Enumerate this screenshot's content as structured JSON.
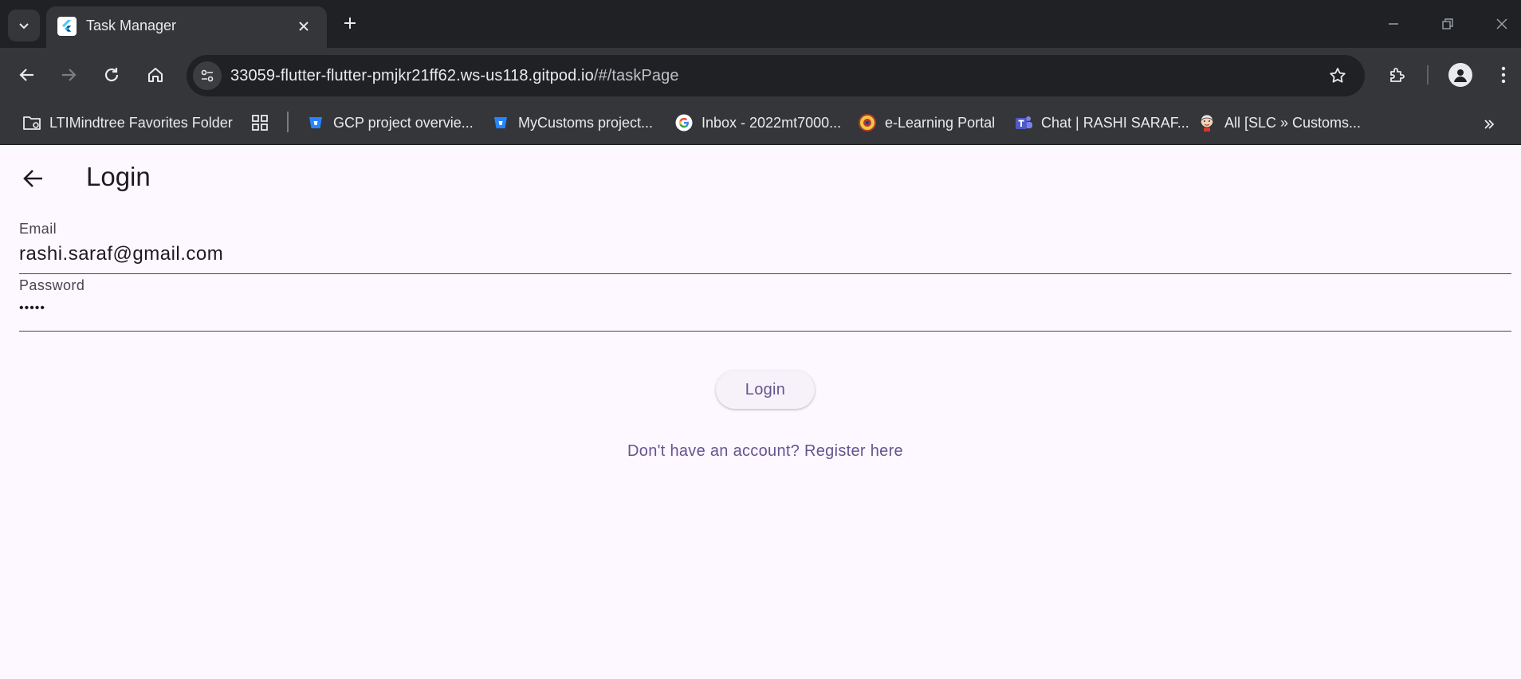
{
  "browser": {
    "tab": {
      "title": "Task Manager"
    },
    "address_bar": {
      "url_host": "33059-flutter-flutter-pmjkr21ff62.ws-us118.gitpod.io",
      "url_path": "/#/taskPage"
    },
    "bookmarks": [
      {
        "label": "LTIMindtree Favorites Folder",
        "icon": "folder-managed-icon"
      },
      {
        "label": "GCP project overvie...",
        "icon": "bitbucket-icon"
      },
      {
        "label": "MyCustoms project...",
        "icon": "bitbucket-icon"
      },
      {
        "label": "Inbox - 2022mt7000...",
        "icon": "google-icon"
      },
      {
        "label": "e-Learning Portal",
        "icon": "emblem-icon"
      },
      {
        "label": "Chat | RASHI SARAF...",
        "icon": "teams-icon"
      },
      {
        "label": "All [SLC » Customs...",
        "icon": "jenkins-icon"
      }
    ]
  },
  "app": {
    "title": "Login",
    "email": {
      "label": "Email",
      "value": "rashi.saraf@gmail.com"
    },
    "password": {
      "label": "Password",
      "value": "•••••"
    },
    "login_button": "Login",
    "register_link": "Don't have an account? Register here"
  },
  "colors": {
    "chrome_dark": "#202124",
    "chrome_toolbar": "#35363a",
    "page_background": "#fdf7ff",
    "primary_text": "#1d1b20",
    "accent": "#65558f"
  }
}
